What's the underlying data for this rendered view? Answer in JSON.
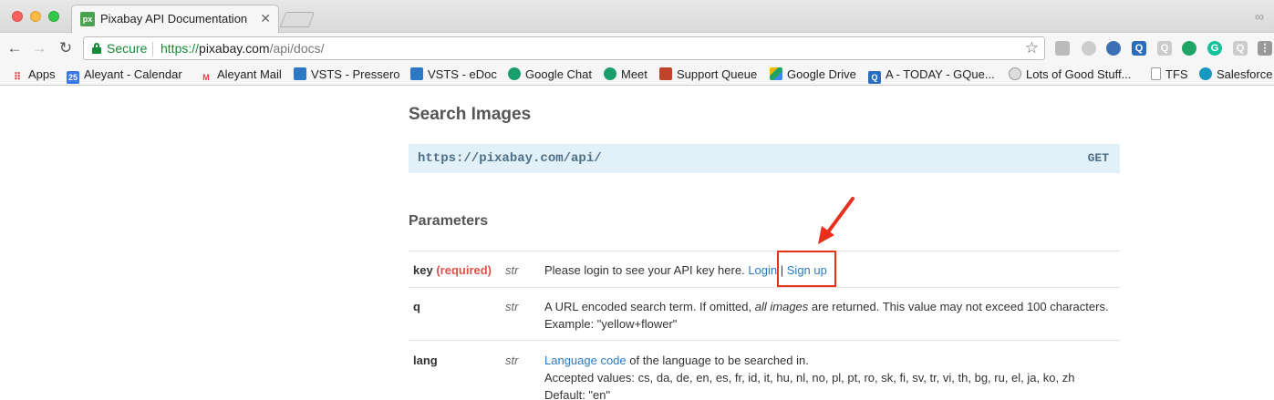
{
  "browser": {
    "tab_title": "Pixabay API Documentation",
    "tab_favicon_text": "px",
    "secure_label": "Secure",
    "url_scheme": "https://",
    "url_host": "pixabay.com",
    "url_path": "/api/docs/"
  },
  "bookmarks": [
    {
      "label": "Apps",
      "icon": "apps-grid-icon"
    },
    {
      "label": "Aleyant - Calendar",
      "icon": "calendar-icon",
      "icon_text": "25"
    },
    {
      "label": "Aleyant Mail",
      "icon": "gmail-icon",
      "icon_text": "M"
    },
    {
      "label": "VSTS - Pressero",
      "icon": "vsts-icon"
    },
    {
      "label": "VSTS - eDoc",
      "icon": "vsts-icon"
    },
    {
      "label": "Google Chat",
      "icon": "chat-icon"
    },
    {
      "label": "Meet",
      "icon": "meet-icon"
    },
    {
      "label": "Support Queue",
      "icon": "support-icon"
    },
    {
      "label": "Google Drive",
      "icon": "drive-icon"
    },
    {
      "label": "A - TODAY - GQue...",
      "icon": "q-icon",
      "icon_text": "Q"
    },
    {
      "label": "Lots of Good Stuff...",
      "icon": "globe-icon"
    },
    {
      "label": "TFS",
      "icon": "page-icon"
    },
    {
      "label": "Salesforce",
      "icon": "cloud-icon"
    }
  ],
  "page": {
    "section_title": "Search Images",
    "endpoint_url": "https://pixabay.com/api/",
    "endpoint_method": "GET",
    "params_title": "Parameters",
    "params": [
      {
        "name": "key",
        "required_label": "(required)",
        "type": "str",
        "desc_text": "Please login to see your API key here. ",
        "login_link": "Login",
        "separator": "|",
        "signup_link": "Sign up"
      },
      {
        "name": "q",
        "type": "str",
        "desc_pre": "A URL encoded search term. If omitted, ",
        "desc_em": "all images",
        "desc_post": " are returned. This value may not exceed 100 characters.",
        "example": "Example: \"yellow+flower\""
      },
      {
        "name": "lang",
        "type": "str",
        "desc_link": "Language code",
        "desc_post": " of the language to be searched in.",
        "accepted": "Accepted values: cs, da, de, en, es, fr, id, it, hu, nl, no, pl, pt, ro, sk, fi, sv, tr, vi, th, bg, ru, el, ja, ko, zh",
        "default": "Default: \"en\""
      }
    ]
  },
  "annotation": {
    "color": "#e8301c"
  }
}
